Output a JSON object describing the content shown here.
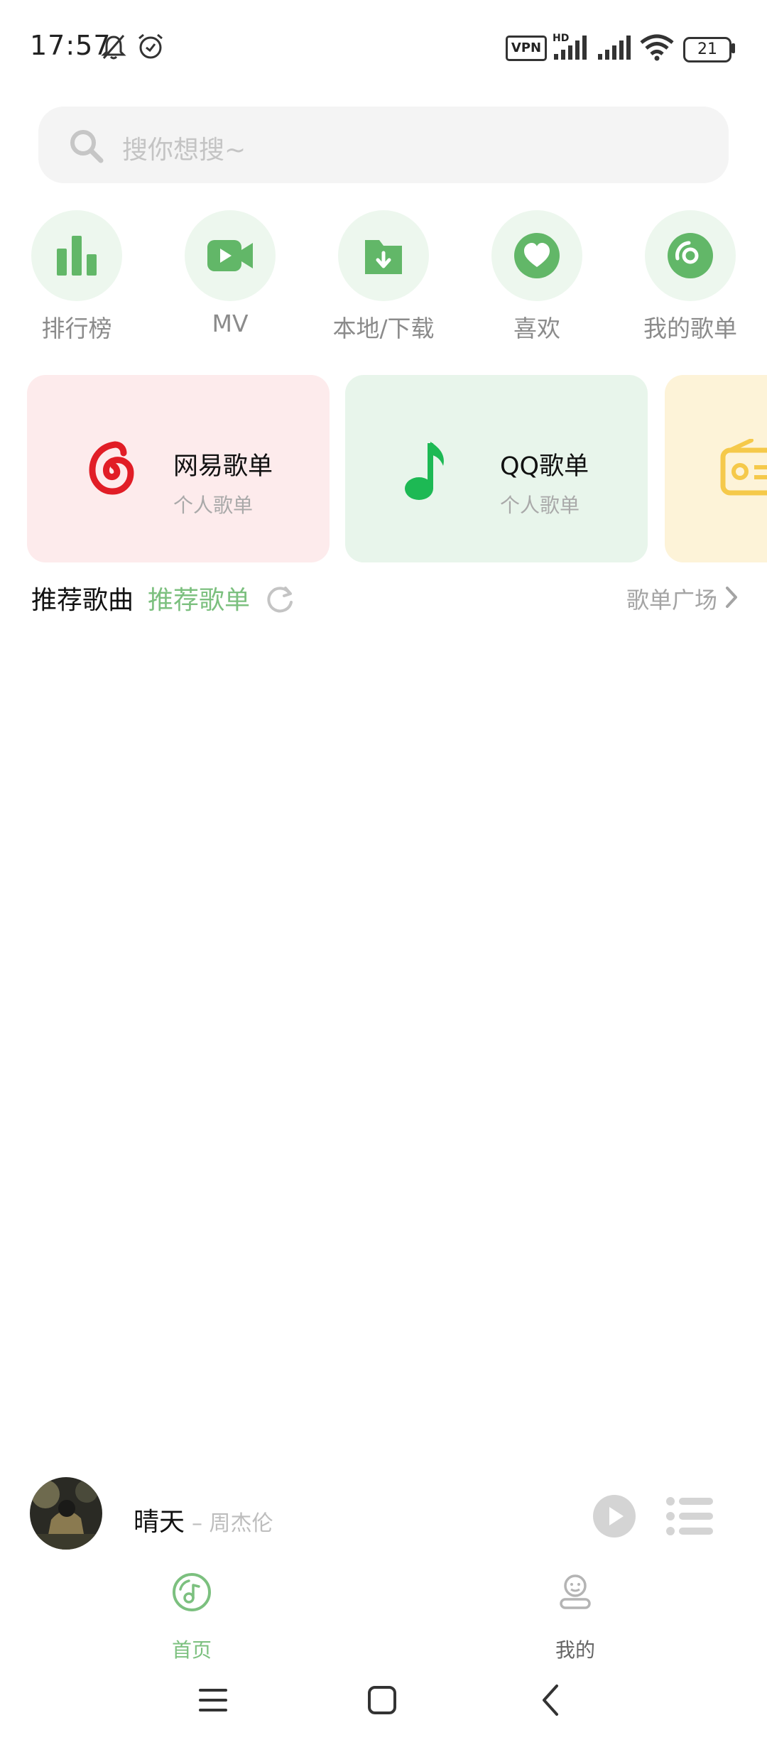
{
  "status_bar": {
    "time": "17:57",
    "vpn_label": "VPN",
    "hd_label": "HD",
    "battery": "21",
    "icons": [
      "bell-off-icon",
      "alarm-icon",
      "vpn-icon",
      "signal-icon",
      "signal-icon",
      "wifi-icon",
      "battery-icon"
    ]
  },
  "search": {
    "placeholder": "搜你想搜~",
    "icon": "search-icon"
  },
  "quick_entries": [
    {
      "label": "排行榜",
      "icon": "bar-chart-icon"
    },
    {
      "label": "MV",
      "icon": "video-icon"
    },
    {
      "label": "本地/下载",
      "icon": "download-folder-icon"
    },
    {
      "label": "喜欢",
      "icon": "heart-icon"
    },
    {
      "label": "我的歌单",
      "icon": "disc-icon"
    }
  ],
  "playlist_cards": [
    {
      "title": "网易歌单",
      "subtitle": "个人歌单",
      "icon": "netease-music-icon",
      "bg": "#fdebec"
    },
    {
      "title": "QQ歌单",
      "subtitle": "个人歌单",
      "icon": "qq-music-icon",
      "bg": "#e8f5eb"
    },
    {
      "title": "",
      "subtitle": "",
      "icon": "radio-icon",
      "bg": "#fdf3d8"
    }
  ],
  "recommend": {
    "tab_songs": "推荐歌曲",
    "tab_playlists": "推荐歌单",
    "plaza": "歌单广场"
  },
  "player": {
    "song": "晴天",
    "artist": "– 周杰伦"
  },
  "bottom_nav": [
    {
      "label": "首页",
      "icon": "music-disc-icon",
      "active": true
    },
    {
      "label": "我的",
      "icon": "profile-icon",
      "active": false
    }
  ],
  "colors": {
    "accent": "#7cc07f",
    "icon_green": "#62b768",
    "netease_red": "#e11d26",
    "qq_green": "#1db954",
    "radio_yellow": "#f5c94a"
  }
}
